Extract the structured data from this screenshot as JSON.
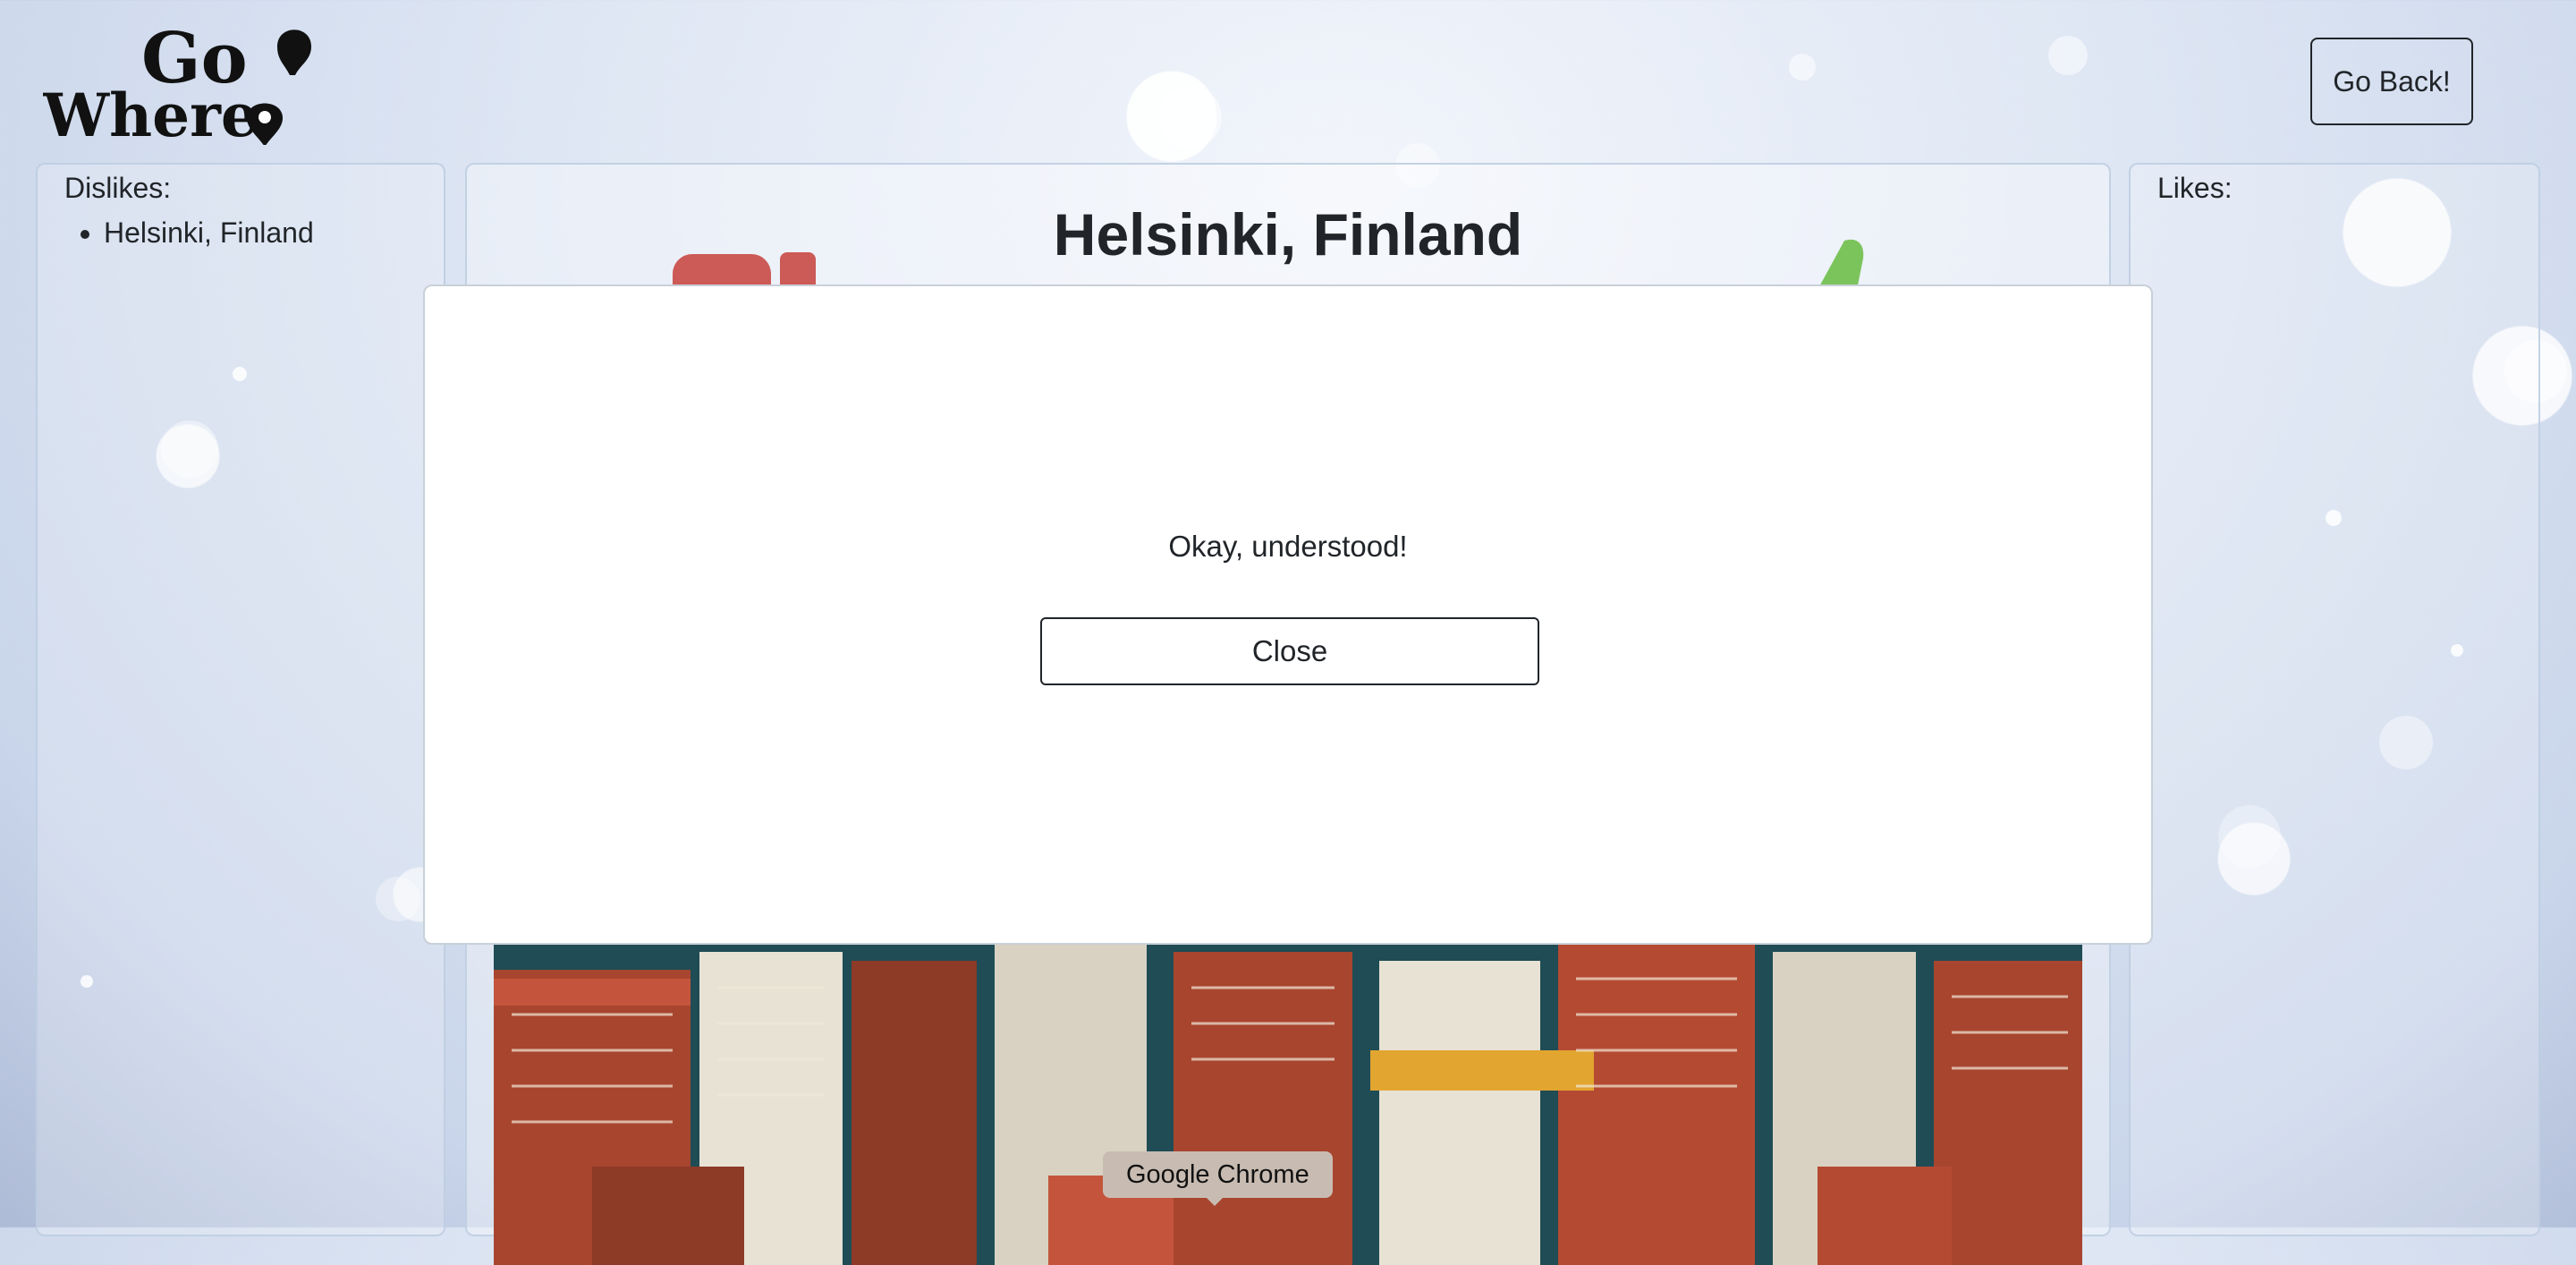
{
  "header": {
    "logo_text_line1": "Go",
    "logo_text_line2": "Where",
    "go_back_label": "Go Back!"
  },
  "dislikes": {
    "title": "Dislikes:",
    "items": [
      "Helsinki, Finland"
    ]
  },
  "likes": {
    "title": "Likes:",
    "items": []
  },
  "destination": {
    "name": "Helsinki, Finland"
  },
  "modal": {
    "message": "Okay, understood!",
    "close_label": "Close"
  },
  "tooltip": {
    "text": "Google Chrome"
  },
  "colors": {
    "dislike": "#cc5a56",
    "like": "#7bc45c",
    "building_red": "#a8452f",
    "building_teal": "#1f4c55",
    "building_yellow": "#e2a52f"
  },
  "icons": {
    "dislike": "thumbs-down-icon",
    "like": "thumbs-up-icon",
    "logo_pin": "location-pin-icon"
  }
}
